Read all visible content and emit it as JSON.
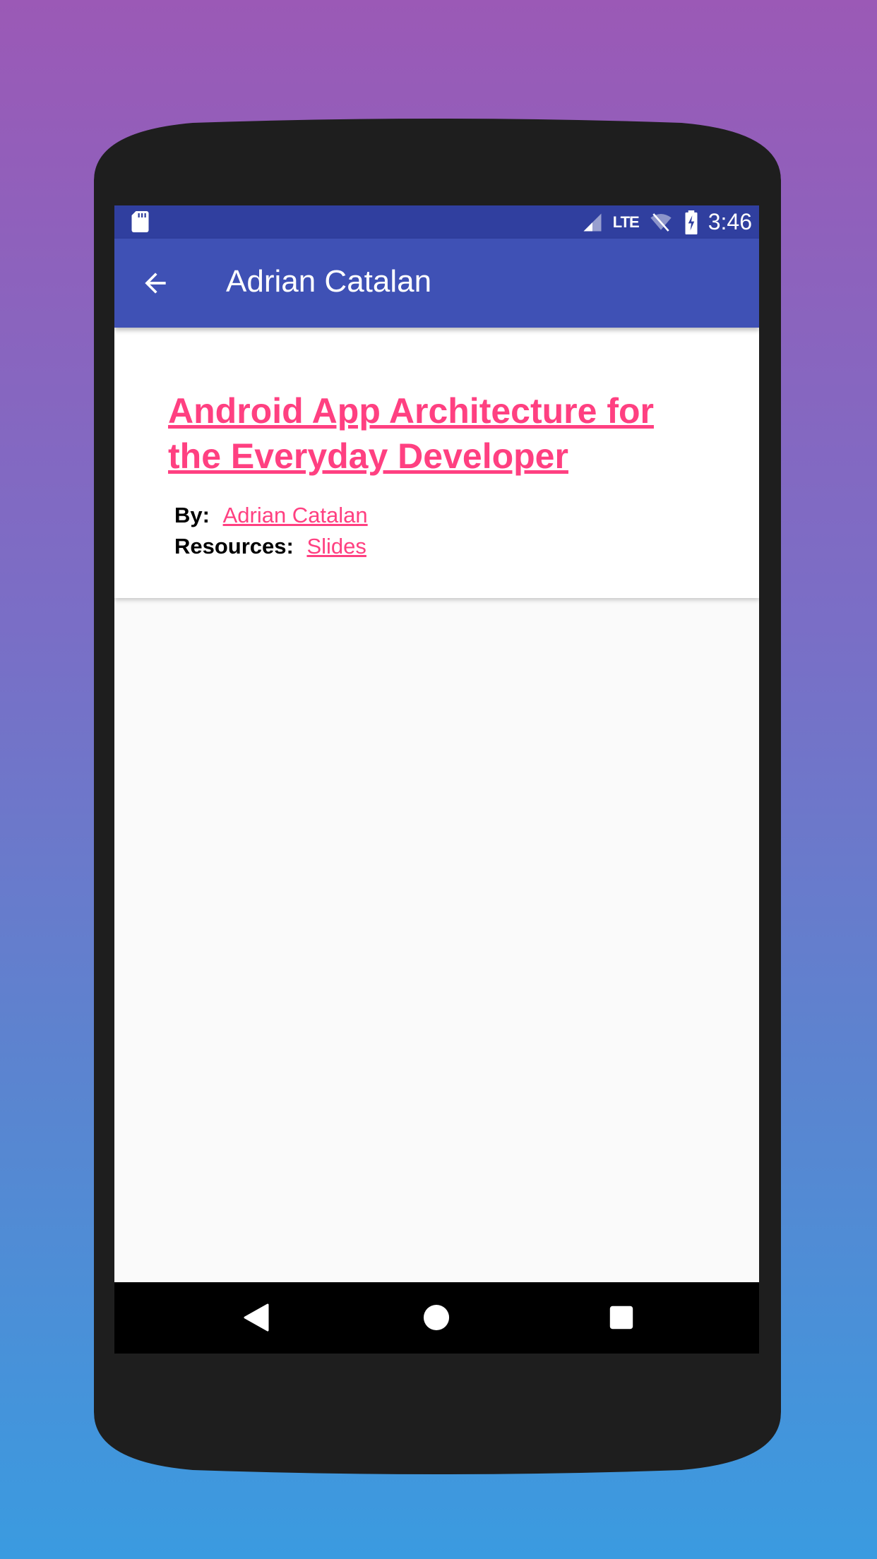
{
  "status_bar": {
    "time": "3:46",
    "network_label": "LTE",
    "icons": [
      "sd-card-icon",
      "signal-icon",
      "wifi-off-icon",
      "battery-charging-icon"
    ]
  },
  "app_bar": {
    "title": "Adrian Catalan",
    "back_icon": "arrow-back-icon"
  },
  "talk": {
    "title": "Android App Architecture for the Everyday Developer",
    "by_label": "By:",
    "speaker": "Adrian Catalan",
    "resources_label": "Resources:",
    "resource_link": "Slides"
  },
  "nav_bar": {
    "icons": [
      "nav-back-icon",
      "nav-home-icon",
      "nav-recents-icon"
    ]
  },
  "colors": {
    "status_bar": "#303f9f",
    "app_bar": "#3f51b5",
    "accent": "#ff4081",
    "background_top": "#9b59b6",
    "background_bottom": "#3a9be0",
    "phone_body": "#1e1e1e"
  }
}
